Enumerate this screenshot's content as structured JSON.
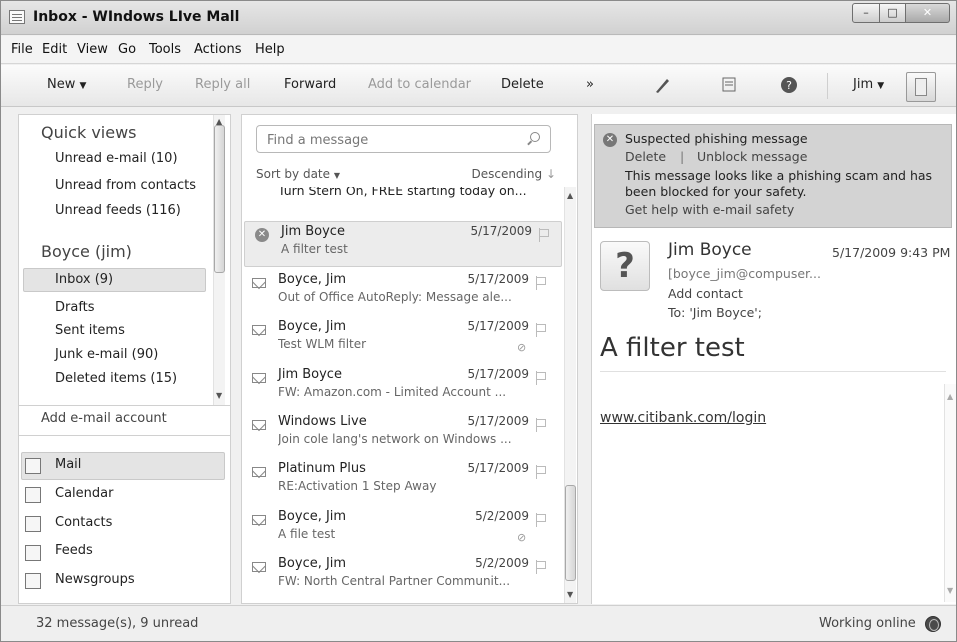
{
  "window": {
    "title": "Inbox - WIndows LIve Mall"
  },
  "menu": [
    "File",
    "Edit",
    "View",
    "Go",
    "Tools",
    "Actions",
    "Help"
  ],
  "toolbar": {
    "new": "New",
    "reply": "Reply",
    "reply_all": "Reply all",
    "forward": "Forward",
    "add_to_calendar": "Add to calendar",
    "delete": "Delete",
    "more": "»",
    "user": "Jim"
  },
  "sidebar": {
    "quick_views_title": "Quick views",
    "quick_views": [
      "Unread e-mail  (10)",
      "Unread from contacts",
      "Unread feeds  (116)"
    ],
    "account_title": "Boyce (jim)",
    "folders": [
      "Inbox  (9)",
      "Drafts",
      "Sent items",
      "Junk e-mail  (90)",
      "Deleted items  (15)"
    ],
    "add_account": "Add e-mail account",
    "nav": [
      "Mail",
      "Calendar",
      "Contacts",
      "Feeds",
      "Newsgroups"
    ]
  },
  "search": {
    "placeholder": "Find a message"
  },
  "sort": {
    "by": "Sort by date",
    "order": "Descending"
  },
  "messages": [
    {
      "from": "",
      "date": "",
      "subject": "Turn Stern On, FREE starting today on..."
    },
    {
      "from": "Jim Boyce",
      "date": "5/17/2009",
      "subject": "A filter test"
    },
    {
      "from": "Boyce, Jim",
      "date": "5/17/2009",
      "subject": "Out of Office AutoReply: Message ale..."
    },
    {
      "from": "Boyce, Jim",
      "date": "5/17/2009",
      "subject": "Test WLM filter"
    },
    {
      "from": "Jim Boyce",
      "date": "5/17/2009",
      "subject": "FW: Amazon.com - Limited Account ..."
    },
    {
      "from": "Windows Live",
      "date": "5/17/2009",
      "subject": "Join cole lang's network on Windows ..."
    },
    {
      "from": "Platinum Plus",
      "date": "5/17/2009",
      "subject": "RE:Activation 1 Step Away"
    },
    {
      "from": "Boyce, Jim",
      "date": "5/2/2009",
      "subject": "A file test"
    },
    {
      "from": "Boyce, Jim",
      "date": "5/2/2009",
      "subject": "FW: North Central Partner Communit..."
    }
  ],
  "reading": {
    "warning_title": "Suspected phishing message",
    "warning_delete": "Delete",
    "warning_sep": "|",
    "warning_unblock": "Unblock message",
    "warning_body": "This message looks like a phishing scam and has been blocked for your safety.",
    "warning_help": "Get help with e-mail safety",
    "sender_name": "Jim Boyce",
    "sender_date": "5/17/2009 9:43 PM",
    "sender_email": "[boyce_jim@compuser...",
    "add_contact": "Add contact",
    "to_label": "To:",
    "to_value": "'Jim Boyce';",
    "subject": "A filter test",
    "link": "www.citibank.com/login"
  },
  "status": {
    "left": "32 message(s), 9 unread",
    "right": "Working online"
  }
}
